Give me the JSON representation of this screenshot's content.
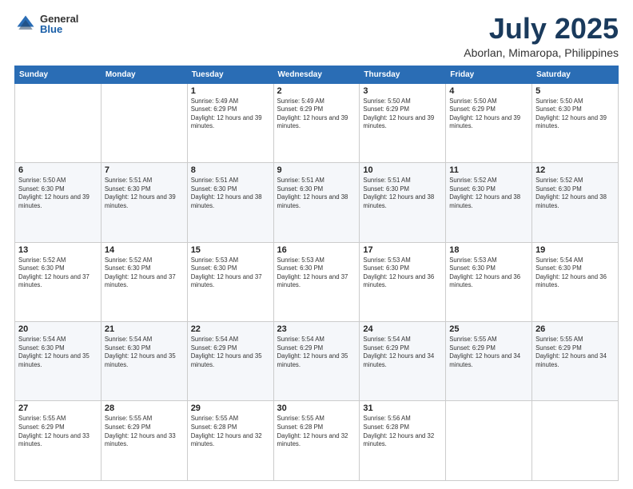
{
  "logo": {
    "general": "General",
    "blue": "Blue"
  },
  "title": "July 2025",
  "subtitle": "Aborlan, Mimaropa, Philippines",
  "days_of_week": [
    "Sunday",
    "Monday",
    "Tuesday",
    "Wednesday",
    "Thursday",
    "Friday",
    "Saturday"
  ],
  "weeks": [
    [
      {
        "day": "",
        "sunrise": "",
        "sunset": "",
        "daylight": ""
      },
      {
        "day": "",
        "sunrise": "",
        "sunset": "",
        "daylight": ""
      },
      {
        "day": "1",
        "sunrise": "Sunrise: 5:49 AM",
        "sunset": "Sunset: 6:29 PM",
        "daylight": "Daylight: 12 hours and 39 minutes."
      },
      {
        "day": "2",
        "sunrise": "Sunrise: 5:49 AM",
        "sunset": "Sunset: 6:29 PM",
        "daylight": "Daylight: 12 hours and 39 minutes."
      },
      {
        "day": "3",
        "sunrise": "Sunrise: 5:50 AM",
        "sunset": "Sunset: 6:29 PM",
        "daylight": "Daylight: 12 hours and 39 minutes."
      },
      {
        "day": "4",
        "sunrise": "Sunrise: 5:50 AM",
        "sunset": "Sunset: 6:29 PM",
        "daylight": "Daylight: 12 hours and 39 minutes."
      },
      {
        "day": "5",
        "sunrise": "Sunrise: 5:50 AM",
        "sunset": "Sunset: 6:30 PM",
        "daylight": "Daylight: 12 hours and 39 minutes."
      }
    ],
    [
      {
        "day": "6",
        "sunrise": "Sunrise: 5:50 AM",
        "sunset": "Sunset: 6:30 PM",
        "daylight": "Daylight: 12 hours and 39 minutes."
      },
      {
        "day": "7",
        "sunrise": "Sunrise: 5:51 AM",
        "sunset": "Sunset: 6:30 PM",
        "daylight": "Daylight: 12 hours and 39 minutes."
      },
      {
        "day": "8",
        "sunrise": "Sunrise: 5:51 AM",
        "sunset": "Sunset: 6:30 PM",
        "daylight": "Daylight: 12 hours and 38 minutes."
      },
      {
        "day": "9",
        "sunrise": "Sunrise: 5:51 AM",
        "sunset": "Sunset: 6:30 PM",
        "daylight": "Daylight: 12 hours and 38 minutes."
      },
      {
        "day": "10",
        "sunrise": "Sunrise: 5:51 AM",
        "sunset": "Sunset: 6:30 PM",
        "daylight": "Daylight: 12 hours and 38 minutes."
      },
      {
        "day": "11",
        "sunrise": "Sunrise: 5:52 AM",
        "sunset": "Sunset: 6:30 PM",
        "daylight": "Daylight: 12 hours and 38 minutes."
      },
      {
        "day": "12",
        "sunrise": "Sunrise: 5:52 AM",
        "sunset": "Sunset: 6:30 PM",
        "daylight": "Daylight: 12 hours and 38 minutes."
      }
    ],
    [
      {
        "day": "13",
        "sunrise": "Sunrise: 5:52 AM",
        "sunset": "Sunset: 6:30 PM",
        "daylight": "Daylight: 12 hours and 37 minutes."
      },
      {
        "day": "14",
        "sunrise": "Sunrise: 5:52 AM",
        "sunset": "Sunset: 6:30 PM",
        "daylight": "Daylight: 12 hours and 37 minutes."
      },
      {
        "day": "15",
        "sunrise": "Sunrise: 5:53 AM",
        "sunset": "Sunset: 6:30 PM",
        "daylight": "Daylight: 12 hours and 37 minutes."
      },
      {
        "day": "16",
        "sunrise": "Sunrise: 5:53 AM",
        "sunset": "Sunset: 6:30 PM",
        "daylight": "Daylight: 12 hours and 37 minutes."
      },
      {
        "day": "17",
        "sunrise": "Sunrise: 5:53 AM",
        "sunset": "Sunset: 6:30 PM",
        "daylight": "Daylight: 12 hours and 36 minutes."
      },
      {
        "day": "18",
        "sunrise": "Sunrise: 5:53 AM",
        "sunset": "Sunset: 6:30 PM",
        "daylight": "Daylight: 12 hours and 36 minutes."
      },
      {
        "day": "19",
        "sunrise": "Sunrise: 5:54 AM",
        "sunset": "Sunset: 6:30 PM",
        "daylight": "Daylight: 12 hours and 36 minutes."
      }
    ],
    [
      {
        "day": "20",
        "sunrise": "Sunrise: 5:54 AM",
        "sunset": "Sunset: 6:30 PM",
        "daylight": "Daylight: 12 hours and 35 minutes."
      },
      {
        "day": "21",
        "sunrise": "Sunrise: 5:54 AM",
        "sunset": "Sunset: 6:30 PM",
        "daylight": "Daylight: 12 hours and 35 minutes."
      },
      {
        "day": "22",
        "sunrise": "Sunrise: 5:54 AM",
        "sunset": "Sunset: 6:29 PM",
        "daylight": "Daylight: 12 hours and 35 minutes."
      },
      {
        "day": "23",
        "sunrise": "Sunrise: 5:54 AM",
        "sunset": "Sunset: 6:29 PM",
        "daylight": "Daylight: 12 hours and 35 minutes."
      },
      {
        "day": "24",
        "sunrise": "Sunrise: 5:54 AM",
        "sunset": "Sunset: 6:29 PM",
        "daylight": "Daylight: 12 hours and 34 minutes."
      },
      {
        "day": "25",
        "sunrise": "Sunrise: 5:55 AM",
        "sunset": "Sunset: 6:29 PM",
        "daylight": "Daylight: 12 hours and 34 minutes."
      },
      {
        "day": "26",
        "sunrise": "Sunrise: 5:55 AM",
        "sunset": "Sunset: 6:29 PM",
        "daylight": "Daylight: 12 hours and 34 minutes."
      }
    ],
    [
      {
        "day": "27",
        "sunrise": "Sunrise: 5:55 AM",
        "sunset": "Sunset: 6:29 PM",
        "daylight": "Daylight: 12 hours and 33 minutes."
      },
      {
        "day": "28",
        "sunrise": "Sunrise: 5:55 AM",
        "sunset": "Sunset: 6:29 PM",
        "daylight": "Daylight: 12 hours and 33 minutes."
      },
      {
        "day": "29",
        "sunrise": "Sunrise: 5:55 AM",
        "sunset": "Sunset: 6:28 PM",
        "daylight": "Daylight: 12 hours and 32 minutes."
      },
      {
        "day": "30",
        "sunrise": "Sunrise: 5:55 AM",
        "sunset": "Sunset: 6:28 PM",
        "daylight": "Daylight: 12 hours and 32 minutes."
      },
      {
        "day": "31",
        "sunrise": "Sunrise: 5:56 AM",
        "sunset": "Sunset: 6:28 PM",
        "daylight": "Daylight: 12 hours and 32 minutes."
      },
      {
        "day": "",
        "sunrise": "",
        "sunset": "",
        "daylight": ""
      },
      {
        "day": "",
        "sunrise": "",
        "sunset": "",
        "daylight": ""
      }
    ]
  ]
}
